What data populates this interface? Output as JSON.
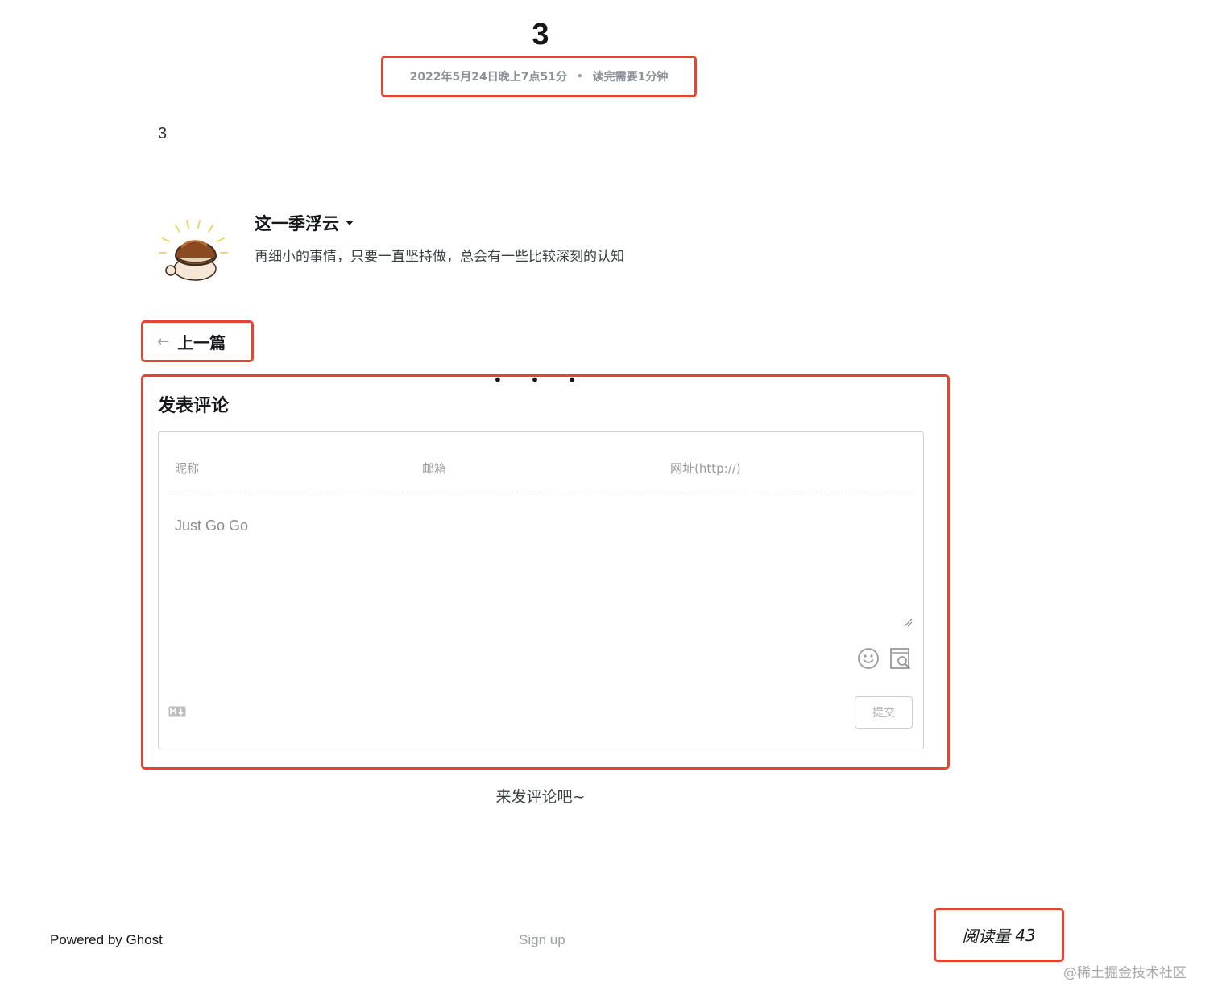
{
  "post": {
    "title": "3",
    "date": "2022年5月24日晚上7点51分",
    "separator": "•",
    "reading_time": "读完需要1分钟",
    "content": "3"
  },
  "author": {
    "name": "这一季浮云",
    "bio": "再细小的事情，只要一直坚持做，总会有一些比较深刻的认知"
  },
  "navigation": {
    "prev_arrow": "←",
    "prev_label": "上一篇"
  },
  "ellipsis": "• • •",
  "comments": {
    "heading": "发表评论",
    "nickname_placeholder": "昵称",
    "email_placeholder": "邮箱",
    "url_placeholder": "网址(http://)",
    "textarea_placeholder": "Just Go Go",
    "submit_label": "提交",
    "empty_text": "来发评论吧~"
  },
  "footer": {
    "powered_by": "Powered by Ghost",
    "signup": "Sign up",
    "reads_label": "阅读量",
    "reads_count": "43"
  },
  "watermark": "@稀土掘金技术社区",
  "colors": {
    "highlight": "#e8432f",
    "muted": "#9aa0a6"
  }
}
